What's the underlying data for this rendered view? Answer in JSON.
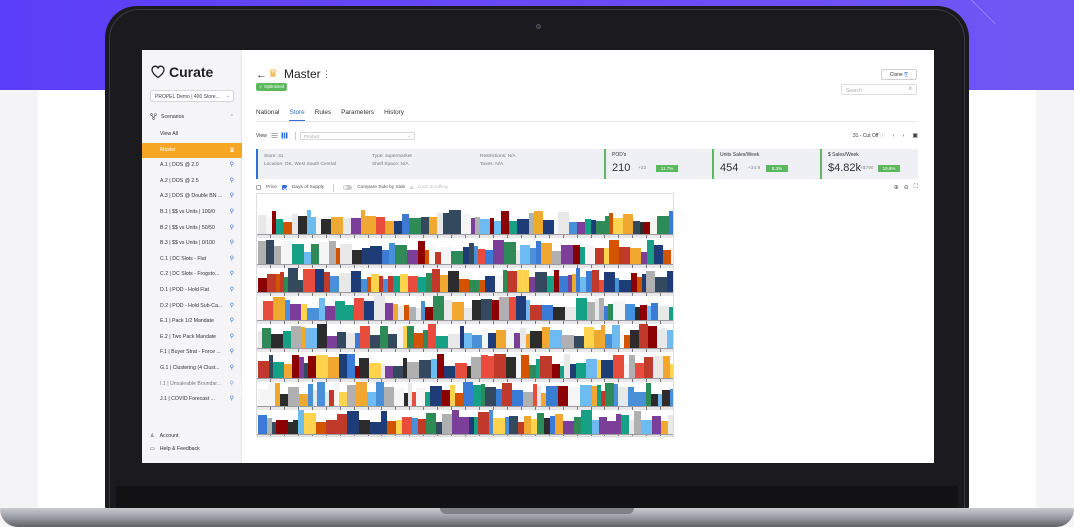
{
  "app": {
    "name": "Curate",
    "org_selector": "PROPEL Demo | 400 Store...",
    "scenarios_label": "Scenarios",
    "view_all": "View All",
    "scenarios": [
      {
        "label": "Master",
        "active": true
      },
      {
        "label": "A.1 | DOS @ 2.0"
      },
      {
        "label": "A.2 | DOS @ 2.5"
      },
      {
        "label": "A.3 | DOS @ Double BN ..."
      },
      {
        "label": "B.1 | $$ vs Units | 100/0"
      },
      {
        "label": "B.2 | $$ vs Units | 50/50"
      },
      {
        "label": "B.3 | $$ vs Units | 0/100"
      },
      {
        "label": "C.1 | DC Slots - Flat"
      },
      {
        "label": "C.2 | DC Slots - Frogsto..."
      },
      {
        "label": "D.1 | POD - Hold Flat"
      },
      {
        "label": "D.2 | POD - Hold Sub-Ca..."
      },
      {
        "label": "E.1 | Pack 1/2 Mandate"
      },
      {
        "label": "E.2 | Two Pack Mandate"
      },
      {
        "label": "F.1 | Buyer Strat - Force ..."
      },
      {
        "label": "G.1 | Clustering (4 Clust..."
      },
      {
        "label": "I.1 | Unsaleable Boundar..."
      },
      {
        "label": "J.1 | COVID Forecast ..."
      }
    ],
    "account_label": "Account",
    "help_label": "Help & Feedback"
  },
  "header": {
    "title": "Master",
    "status_badge": "Optimized",
    "clone_label": "Clone",
    "search_placeholder": "Search"
  },
  "tabs": [
    {
      "label": "National"
    },
    {
      "label": "Store",
      "active": true
    },
    {
      "label": "Rules"
    },
    {
      "label": "Parameters"
    },
    {
      "label": "History"
    }
  ],
  "toolbar": {
    "view_label": "View",
    "product_placeholder": "Product",
    "cutoff_label": "31 - Cut Off"
  },
  "store_info": {
    "store": "Store: 31",
    "location": "Location: OK, West South Central",
    "type": "Type: supermarket",
    "shelf_space": "Shelf Space: N/A",
    "restrictions": "Restrictions: N/A",
    "taxes": "Taxes: N/A"
  },
  "metrics": [
    {
      "label": "POD's",
      "value": "210",
      "delta": "+22",
      "pill": "11.7%"
    },
    {
      "label": "Units Sales/Week",
      "value": "454",
      "delta": "+34.9",
      "pill": "8.3%"
    },
    {
      "label": "$ Sales/Week",
      "value": "$4.82k",
      "delta": "+$790",
      "pill": "19.6%"
    }
  ],
  "options": {
    "price_label": "Price",
    "dos_label": "Days of Supply",
    "compare_label": "Compare Side by Side",
    "lock_label": "Lock Scrolling"
  },
  "colors": {
    "accent": "#2f6fd6",
    "active_scenario": "#f5a623",
    "success": "#5cb85c",
    "hero_band": "#5b3ef7"
  }
}
